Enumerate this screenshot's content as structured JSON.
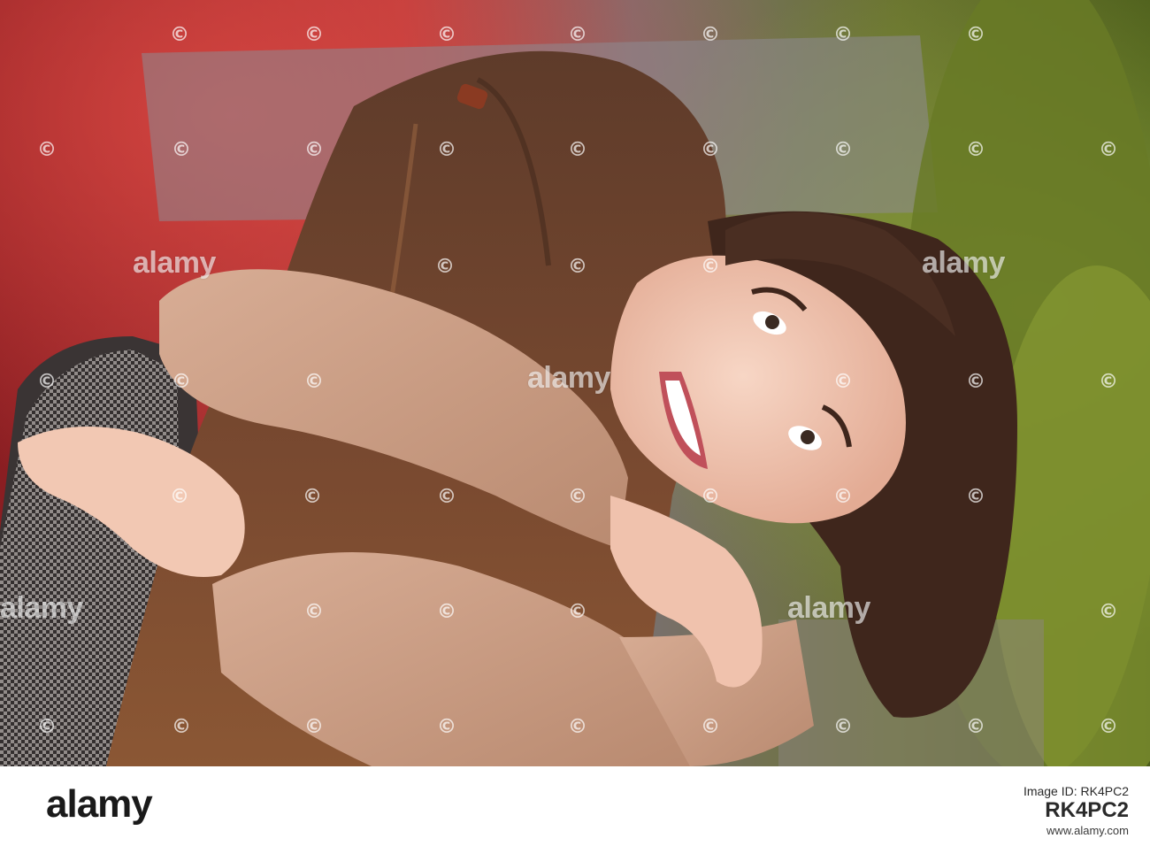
{
  "watermark": {
    "brand": "alamy",
    "symbol": "©"
  },
  "footer": {
    "logo": "alamy",
    "image_id_label": "Image ID: RK4PC2",
    "image_id_value": "RK4PC2",
    "url": "www.alamy.com"
  },
  "colors": {
    "background_red_foliage": "#b0282c",
    "background_green": "#6a7a2a",
    "sweater": "#c79a82",
    "hair_dark": "#4a2e22",
    "skin": "#f0c8b4"
  }
}
